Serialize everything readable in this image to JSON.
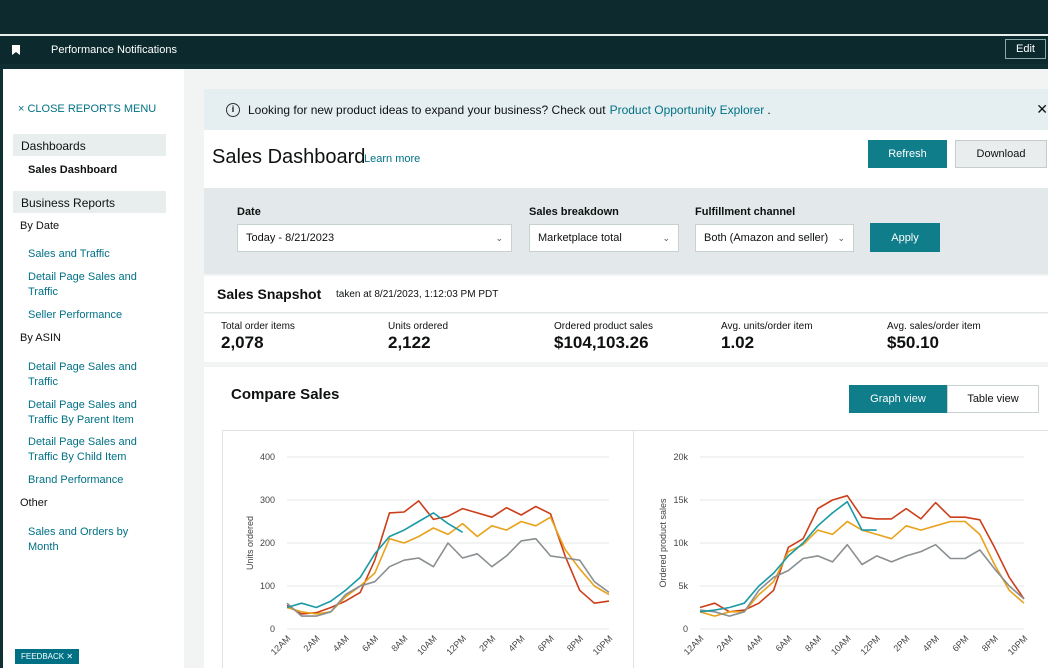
{
  "perfbar": {
    "title": "Performance Notifications",
    "edit": "Edit"
  },
  "sidebar": {
    "close": "× CLOSE REPORTS MENU",
    "dashboards": "Dashboards",
    "sales_dashboard": "Sales Dashboard",
    "business_reports": "Business Reports",
    "by_date": "By Date",
    "sales_traffic": "Sales and Traffic",
    "detail_page": "Detail Page Sales and Traffic",
    "seller_perf": "Seller Performance",
    "by_asin": "By ASIN",
    "asin_detail": "Detail Page Sales and Traffic",
    "asin_parent": "Detail Page Sales and Traffic By Parent Item",
    "asin_child": "Detail Page Sales and Traffic By Child Item",
    "brand_perf": "Brand Performance",
    "other": "Other",
    "sales_orders": "Sales and Orders by Month",
    "feedback": "FEEDBACK ✕"
  },
  "banner": {
    "icon": "info-icon",
    "text": "Looking for new product ideas to expand your business? Check out",
    "link": "Product Opportunity Explorer",
    "tail": ".",
    "close": "✕"
  },
  "header": {
    "title": "Sales Dashboard",
    "learn": "Learn more",
    "refresh": "Refresh",
    "download": "Download"
  },
  "filters": {
    "date_label": "Date",
    "date_value": "Today - 8/21/2023",
    "breakdown_label": "Sales breakdown",
    "breakdown_value": "Marketplace total",
    "channel_label": "Fulfillment channel",
    "channel_value": "Both (Amazon and seller)",
    "apply": "Apply"
  },
  "snapshot": {
    "title": "Sales Snapshot",
    "taken": "taken at 8/21/2023, 1:12:03 PM PDT"
  },
  "metrics": [
    {
      "label": "Total order items",
      "value": "2,078"
    },
    {
      "label": "Units ordered",
      "value": "2,122"
    },
    {
      "label": "Ordered product sales",
      "value": "$104,103.26"
    },
    {
      "label": "Avg. units/order item",
      "value": "1.02"
    },
    {
      "label": "Avg. sales/order item",
      "value": "$50.10"
    }
  ],
  "compare": {
    "title": "Compare Sales",
    "graph": "Graph view",
    "table": "Table view"
  },
  "colors": {
    "teal": "#0f7d8a",
    "orange": "#e8a21c",
    "red": "#cc3e1a",
    "gray": "#8a8f91",
    "cyan": "#1a9aa6"
  },
  "chart_data": [
    {
      "type": "line",
      "ylabel": "Units ordered",
      "ylim": [
        0,
        400
      ],
      "yticks": [
        "0",
        "100",
        "200",
        "300",
        "400"
      ],
      "xticks": [
        "12AM",
        "2AM",
        "4AM",
        "6AM",
        "8AM",
        "10AM",
        "12PM",
        "2PM",
        "4PM",
        "6PM",
        "8PM",
        "10PM"
      ],
      "series": [
        {
          "color": "#cc3e1a",
          "values": [
            55,
            35,
            38,
            50,
            65,
            85,
            160,
            270,
            272,
            298,
            255,
            262,
            280,
            270,
            260,
            282,
            265,
            285,
            268,
            170,
            90,
            60,
            65
          ]
        },
        {
          "color": "#e8a21c",
          "values": [
            50,
            40,
            35,
            40,
            75,
            100,
            130,
            210,
            200,
            215,
            235,
            220,
            245,
            215,
            240,
            230,
            250,
            240,
            260,
            185,
            140,
            100,
            80
          ]
        },
        {
          "color": "#8a8f91",
          "values": [
            60,
            30,
            30,
            40,
            80,
            100,
            110,
            145,
            160,
            165,
            145,
            200,
            165,
            175,
            145,
            170,
            205,
            210,
            170,
            165,
            160,
            110,
            85
          ]
        },
        {
          "color": "#1a9aa6",
          "values": [
            50,
            60,
            50,
            65,
            90,
            120,
            175,
            215,
            230,
            250,
            270,
            245,
            225
          ]
        }
      ]
    },
    {
      "type": "line",
      "ylabel": "Ordered product sales",
      "ylim": [
        0,
        20000
      ],
      "yticks": [
        "0",
        "5k",
        "10k",
        "15k",
        "20k"
      ],
      "xticks": [
        "12AM",
        "2AM",
        "4AM",
        "6AM",
        "8AM",
        "10AM",
        "12PM",
        "2PM",
        "4PM",
        "6PM",
        "8PM",
        "10PM"
      ],
      "series": [
        {
          "color": "#cc3e1a",
          "values": [
            2500,
            3000,
            2000,
            2200,
            3000,
            4500,
            9500,
            10500,
            14000,
            15000,
            15500,
            13000,
            12800,
            12800,
            14000,
            12800,
            14700,
            13000,
            13000,
            12700,
            9500,
            6000,
            3500
          ]
        },
        {
          "color": "#e8a21c",
          "values": [
            2000,
            1500,
            2000,
            2000,
            4000,
            5500,
            9000,
            9800,
            11500,
            11000,
            12500,
            11500,
            11000,
            10500,
            12000,
            11500,
            12000,
            12500,
            12500,
            11000,
            7500,
            4500,
            3000
          ]
        },
        {
          "color": "#8a8f91",
          "values": [
            2200,
            2000,
            1500,
            2000,
            4500,
            6000,
            6800,
            8200,
            8500,
            7800,
            9800,
            7500,
            8500,
            7800,
            8500,
            9000,
            9800,
            8200,
            8200,
            9200,
            7000,
            5000,
            3500
          ]
        },
        {
          "color": "#1a9aa6",
          "values": [
            2000,
            2200,
            2500,
            3000,
            5000,
            6500,
            8500,
            10000,
            12000,
            13500,
            14800,
            11500,
            11500
          ]
        }
      ]
    }
  ]
}
